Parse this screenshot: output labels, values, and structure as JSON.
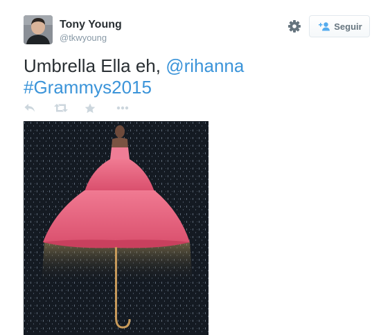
{
  "user": {
    "name": "Tony Young",
    "handle": "@tkwyoung"
  },
  "follow_button": {
    "label": "Seguir"
  },
  "tweet": {
    "text_plain": "Umbrella Ella eh, ",
    "mention": "@rihanna",
    "hashtag": "#Grammys2015"
  },
  "actions": [
    "reply-icon",
    "retweet-icon",
    "favorite-icon",
    "more-icon"
  ],
  "media": {
    "icon": "photo"
  },
  "colors": {
    "link": "#3b94d9",
    "name": "#292f33",
    "muted": "#8899a6",
    "action_icon": "#ccd6dd",
    "dress": "#e8607a"
  }
}
